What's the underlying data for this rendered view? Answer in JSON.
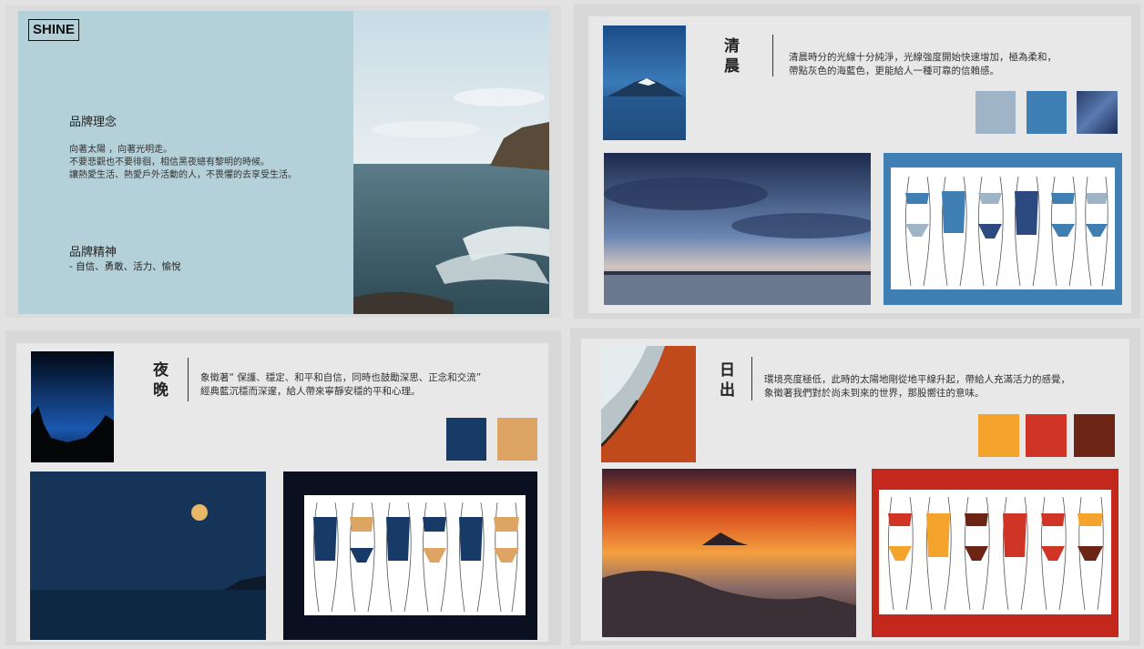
{
  "slide1": {
    "logo": "SHINE",
    "concept_title": "品牌理念",
    "concept_body": "向著太陽 ，向著光明走。\n不要悲觀也不要徘徊，相信黑夜總有黎明的時候。\n讓熱愛生活、熱愛戶外活動的人，不畏懼的去享受生活。",
    "spirit_title": "品牌精神",
    "spirit_values": "- 自信、勇敢、活力、愉悅",
    "bg_color": "#b4d0d8"
  },
  "slide2": {
    "title": "清\n晨",
    "description": "清晨時分的光線十分純淨，光線強度開始快速增加，極為柔和，\n帶點灰色的海藍色，更能給人一種可靠的信賴感。",
    "swatches": [
      "#a0b4c8",
      "#3f7fb4",
      "#2c4a80"
    ],
    "illustration_frame": "#3f7fb4"
  },
  "slide3": {
    "title": "夜\n晚",
    "description": "象徵著“ 保護、穩定、和平和自信，同時也鼓勵深思、正念和交流”\n經典藍沉穩而深邃，給人帶來寧靜安穩的平和心理。",
    "swatches": [
      "#173a66",
      "#dea464"
    ],
    "illustration_frame": "#0a1020"
  },
  "slide4": {
    "title": "日\n出",
    "description": "環境亮度極低，此時的太陽地剛從地平線升起，帶給人充滿活力的感覺，\n象徵著我們對於尚未到來的世界，那股嚮往的意味。",
    "swatches": [
      "#f4a42c",
      "#d03424",
      "#6c2414"
    ],
    "illustration_frame": "#c4281c"
  }
}
